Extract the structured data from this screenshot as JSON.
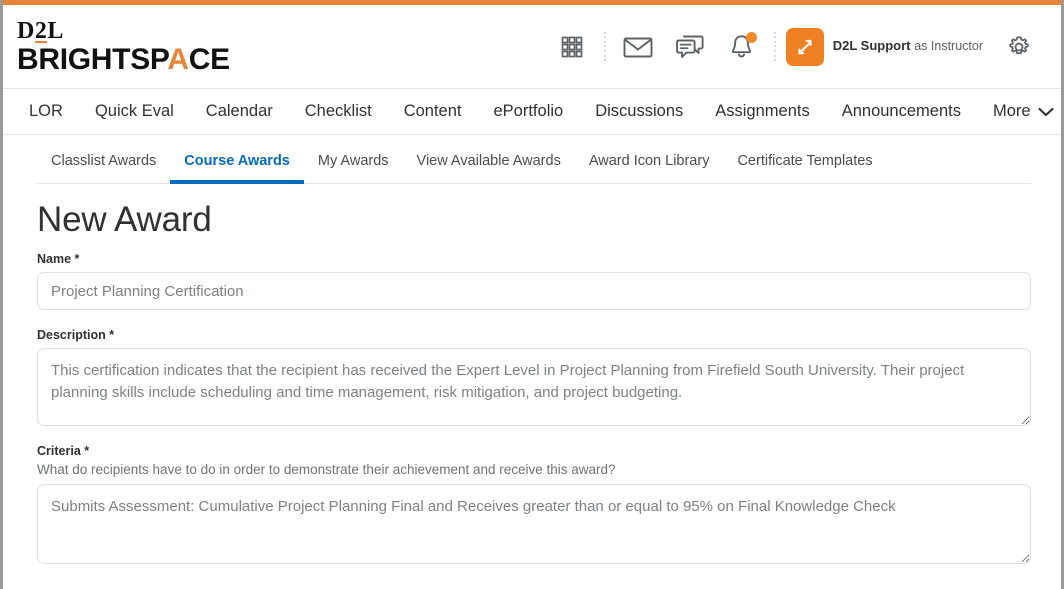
{
  "brand": {
    "logo_top": "D2L",
    "logo_top_a": "D",
    "logo_top_b": "2",
    "logo_top_c": "L",
    "logo_bottom_pre": "BRIGHTSP",
    "logo_bottom_accent": "A",
    "logo_bottom_post": "CE",
    "accent_color": "#e8833a"
  },
  "header": {
    "icons": [
      {
        "name": "waffle-grid-icon",
        "label": "Course Selector"
      },
      {
        "name": "envelope-icon",
        "label": "Message Alerts"
      },
      {
        "name": "chat-bubbles-icon",
        "label": "Subscription Alerts"
      },
      {
        "name": "bell-icon",
        "label": "Update Alerts",
        "badge": true
      }
    ],
    "user": {
      "name": "D2L Support",
      "role": "as Instructor",
      "avatar_icon": "swap-arrows-icon"
    },
    "settings_icon": "gear-icon"
  },
  "main_nav": {
    "items": [
      {
        "label": "LOR"
      },
      {
        "label": "Quick Eval"
      },
      {
        "label": "Calendar"
      },
      {
        "label": "Checklist"
      },
      {
        "label": "Content"
      },
      {
        "label": "ePortfolio"
      },
      {
        "label": "Discussions"
      },
      {
        "label": "Assignments"
      },
      {
        "label": "Announcements"
      }
    ],
    "more_label": "More"
  },
  "subnav": {
    "tabs": [
      {
        "label": "Classlist Awards",
        "active": false
      },
      {
        "label": "Course Awards",
        "active": true
      },
      {
        "label": "My Awards",
        "active": false
      },
      {
        "label": "View Available Awards",
        "active": false
      },
      {
        "label": "Award Icon Library",
        "active": false
      },
      {
        "label": "Certificate Templates",
        "active": false
      }
    ],
    "active_color": "#046bbf"
  },
  "form": {
    "page_title": "New Award",
    "name_field": {
      "label": "Name",
      "required_marker": "*",
      "value": "Project Planning Certification",
      "placeholder": "Project Planning Certification"
    },
    "description_field": {
      "label": "Description",
      "required_marker": "*",
      "value": "This certification indicates that the recipient has received the Expert Level in Project Planning from Firefield South University. Their project planning skills include scheduling and time management, risk mitigation, and project budgeting.",
      "placeholder": ""
    },
    "criteria_field": {
      "label": "Criteria",
      "required_marker": "*",
      "help": "What do recipients have to do in order to demonstrate their achievement and receive this award?",
      "value": "Submits Assessment: Cumulative Project Planning Final and Receives greater than or equal to 95% on Final Knowledge Check",
      "placeholder": ""
    }
  }
}
